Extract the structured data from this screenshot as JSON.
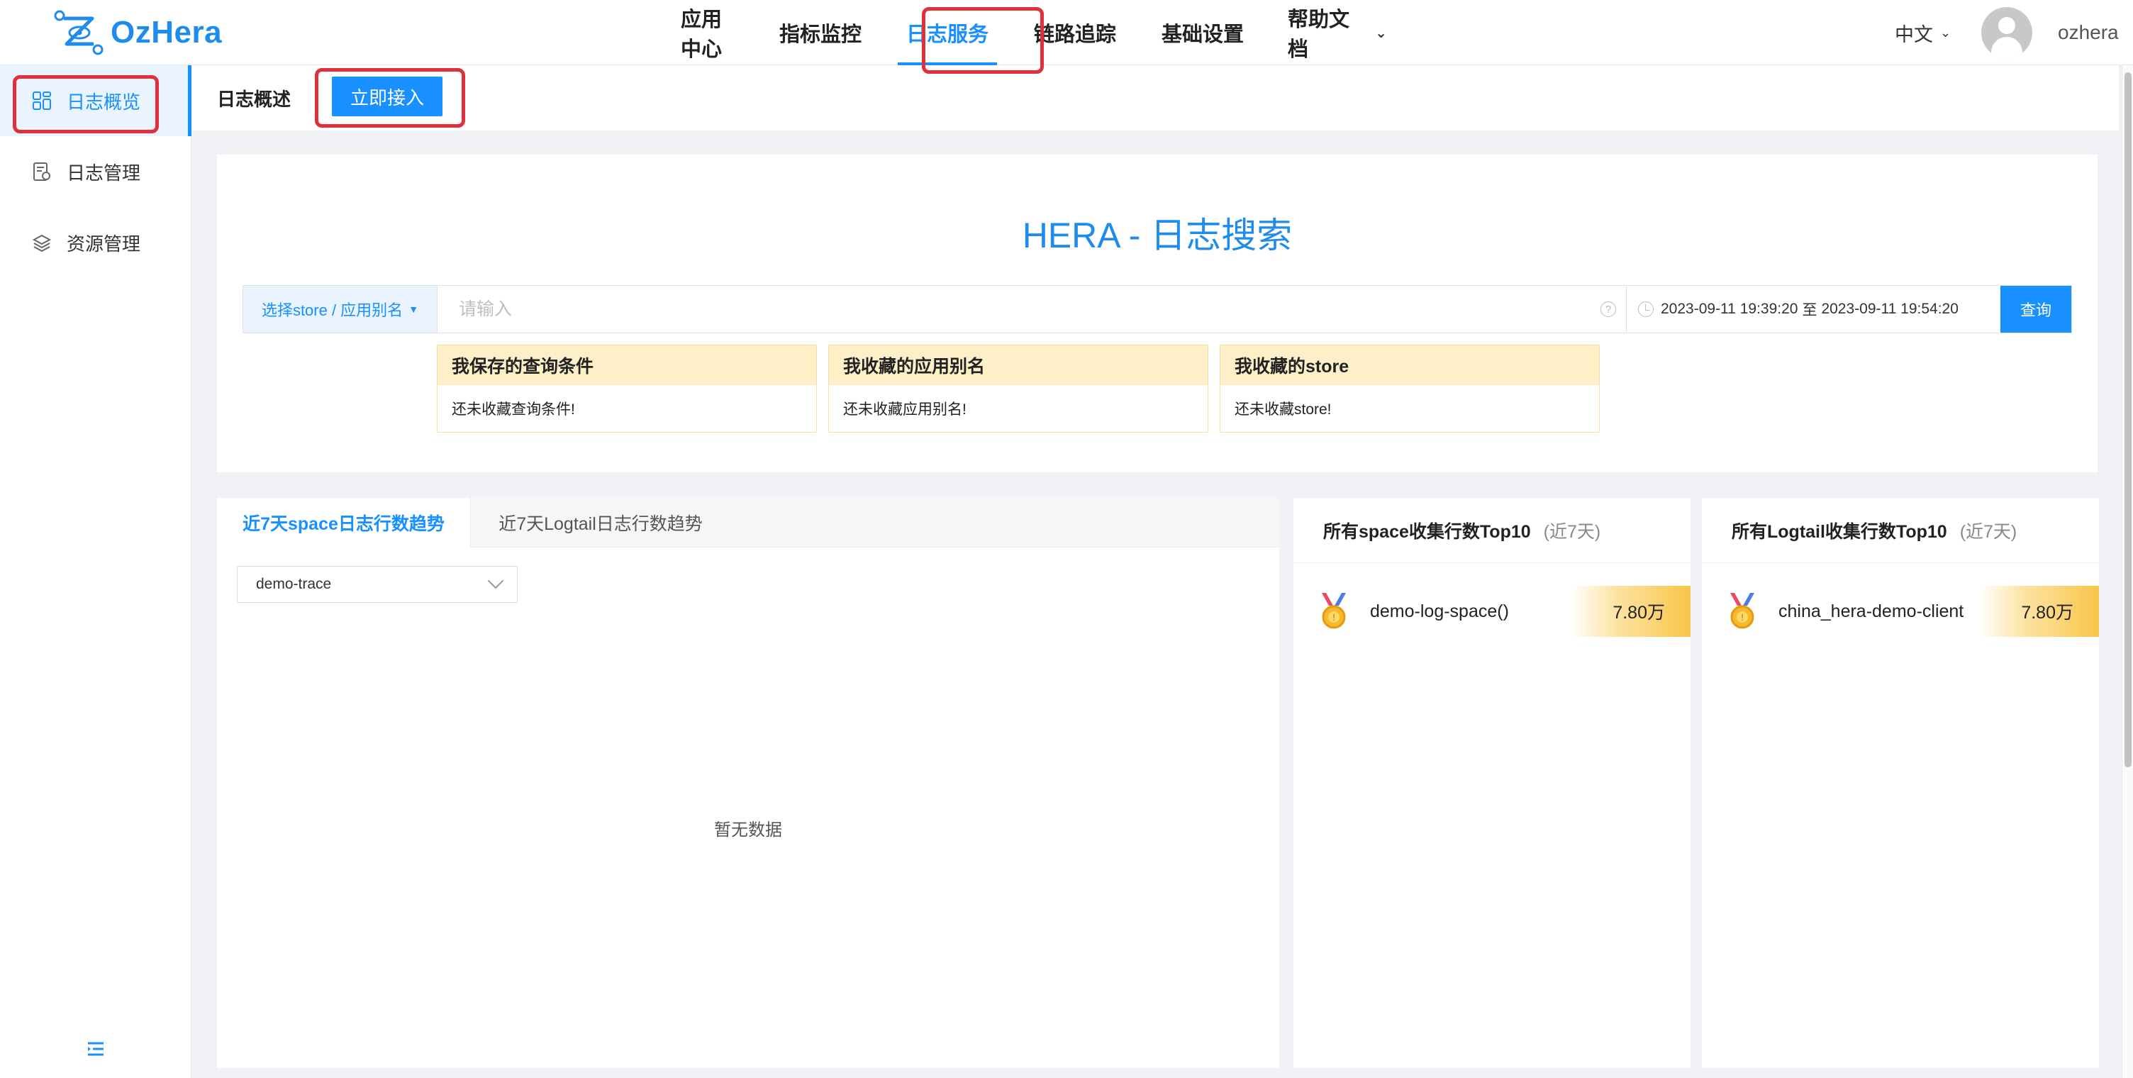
{
  "brand": {
    "name": "OzHera",
    "color": "#1f8ceb"
  },
  "nav": {
    "items": [
      {
        "label": "应用中心"
      },
      {
        "label": "指标监控"
      },
      {
        "label": "日志服务",
        "active": true
      },
      {
        "label": "链路追踪"
      },
      {
        "label": "基础设置"
      },
      {
        "label": "帮助文档",
        "dropdown": true
      }
    ]
  },
  "header": {
    "language": "中文",
    "username": "ozhera"
  },
  "sidebar": {
    "items": [
      {
        "label": "日志概览",
        "icon": "dashboard-icon",
        "active": true
      },
      {
        "label": "日志管理",
        "icon": "log-settings-icon"
      },
      {
        "label": "资源管理",
        "icon": "resource-icon"
      }
    ],
    "collapse_icon": "menu-fold-icon"
  },
  "subheader": {
    "breadcrumb": "日志概述",
    "access_button": "立即接入"
  },
  "search": {
    "title": "HERA - 日志搜索",
    "store_select": "选择store / 应用别名",
    "placeholder": "请输入",
    "help_icon": "?",
    "date_start": "2023-09-11 19:39:20",
    "date_sep": "至",
    "date_end": "2023-09-11 19:54:20",
    "query_button": "查询"
  },
  "favorites": [
    {
      "title": "我保存的查询条件",
      "empty": "还未收藏查询条件!"
    },
    {
      "title": "我收藏的应用别名",
      "empty": "还未收藏应用别名!"
    },
    {
      "title": "我收藏的store",
      "empty": "还未收藏store!"
    }
  ],
  "trend": {
    "tabs": [
      {
        "label": "近7天space日志行数趋势",
        "active": true
      },
      {
        "label": "近7天Logtail日志行数趋势"
      }
    ],
    "select_value": "demo-trace",
    "empty_text": "暂无数据"
  },
  "top_space": {
    "title": "所有space收集行数Top10",
    "period": "(近7天)",
    "rows": [
      {
        "name": "demo-log-space()",
        "value": "7.80万",
        "medal": "gold-medal-icon"
      }
    ]
  },
  "top_logtail": {
    "title": "所有Logtail收集行数Top10",
    "period": "(近7天)",
    "rows": [
      {
        "name": "china_hera-demo-client",
        "value": "7.80万",
        "medal": "gold-medal-icon"
      }
    ]
  },
  "colors": {
    "primary": "#1890ff",
    "highlight": "#e0313a",
    "favorite_header": "#fdefc8"
  }
}
